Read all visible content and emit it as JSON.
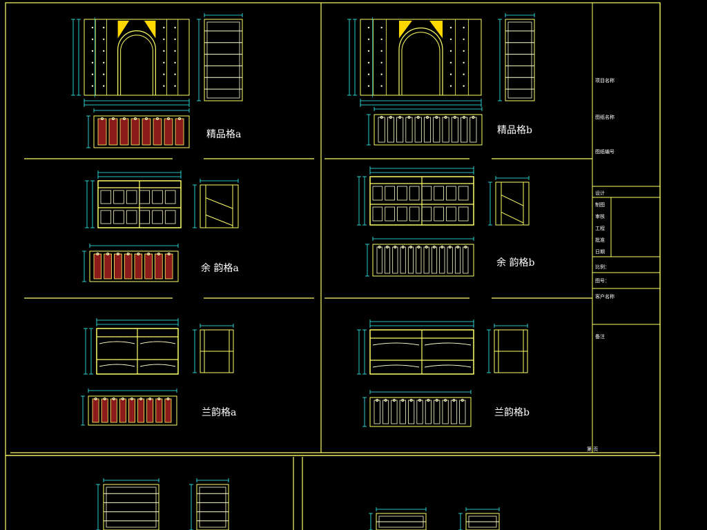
{
  "drawing": {
    "header_text": "",
    "labels": {
      "jingpin_a": "精品格a",
      "jingpin_b": "精品格b",
      "yuan_a": "余 韵格a",
      "yuan_b": "余 韵格b",
      "third_a": "兰韵格a",
      "third_b": "兰韵格b"
    },
    "title_block": {
      "project_name": "项目名称",
      "drawing_name": "图纸名称",
      "drawing_no": "图纸编号",
      "design": "设计",
      "draw": "制图",
      "check": "审核",
      "audit": "工程",
      "approve": "批准",
      "date": "日期",
      "ratio": "比例：",
      "sheet": "图号：",
      "client": "客户名称",
      "remark": "备注",
      "page": "第 页"
    },
    "colors": {
      "background": "#000000",
      "frame": "#ffff66",
      "shelf": "#ffffcc",
      "dimension": "#33ffff",
      "fill": "#8b1a1a",
      "ornament": "#ffd700",
      "text": "#ffffff"
    }
  }
}
